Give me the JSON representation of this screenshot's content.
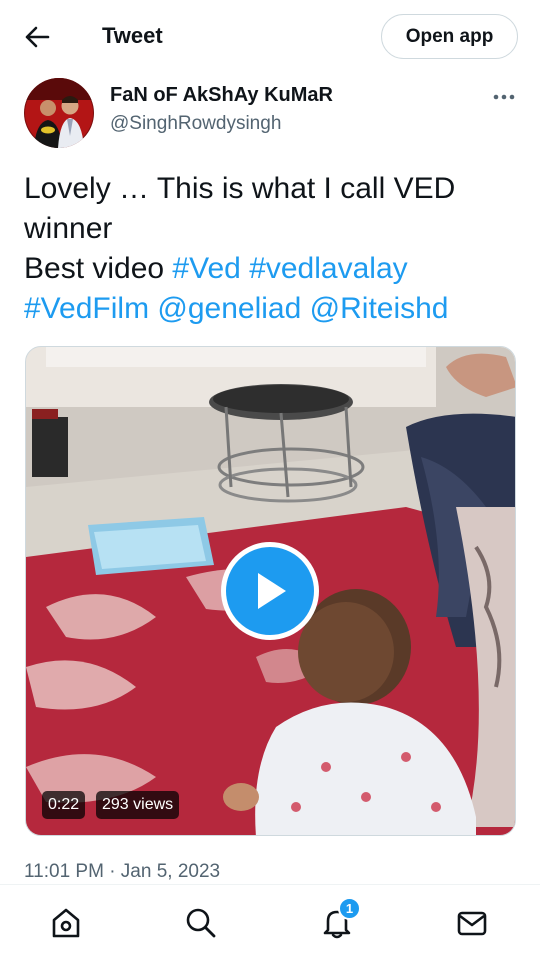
{
  "header": {
    "title": "Tweet",
    "back_icon": "arrow-left-icon",
    "open_app_label": "Open app"
  },
  "author": {
    "display_name": "FaN oF AkShAy KuMaR",
    "handle": "@SinghRowdysingh",
    "more_icon": "more-dots-icon"
  },
  "tweet": {
    "text_line_1": "Lovely … This is what I call VED",
    "text_line_2": "winner",
    "text_line_3_prefix": "Best video ",
    "hashtag_ved": "#Ved",
    "hashtag_vedlavalay": "#vedlavalay",
    "hashtag_vedfilm": "#VedFilm",
    "mention_geneliad": "@geneliad",
    "mention_riteishd": "@Riteishd",
    "timestamp": "11:01 PM · Jan 5, 2023"
  },
  "media": {
    "duration": "0:22",
    "views": "293 views",
    "play_icon": "play-icon"
  },
  "bottom_nav": {
    "items": [
      {
        "icon": "home-icon"
      },
      {
        "icon": "search-icon"
      },
      {
        "icon": "notifications-bell-icon"
      },
      {
        "icon": "messages-mail-icon"
      }
    ],
    "notification_count": "1"
  },
  "colors": {
    "accent": "#1d9bf0",
    "text_primary": "#0f1419",
    "text_secondary": "#536471",
    "border": "#cfd9de"
  }
}
